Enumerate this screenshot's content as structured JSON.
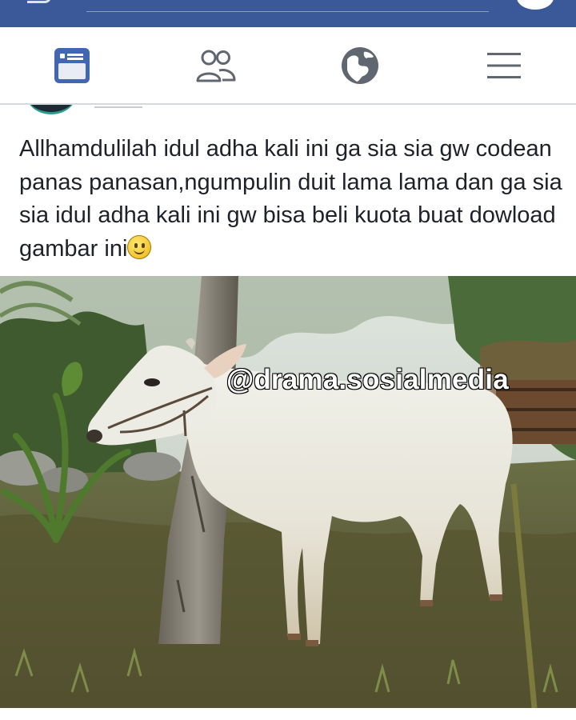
{
  "topbar": {
    "background_color": "#3b5998",
    "left_icon": "partial-icon",
    "right_icon": "messenger-icon"
  },
  "navbar": {
    "items": [
      {
        "icon": "news-feed-icon",
        "active": true,
        "color": "#4267b2"
      },
      {
        "icon": "friends-icon",
        "active": false,
        "color": "#616770"
      },
      {
        "icon": "globe-icon",
        "active": false,
        "color": "#616770"
      },
      {
        "icon": "menu-icon",
        "active": false,
        "color": "#616770"
      }
    ]
  },
  "post": {
    "text": "Allhamdulilah idul adha kali ini  ga sia sia gw codean panas panasan,ngumpulin duit lama lama dan ga sia sia idul adha kali ini gw bisa beli kuota buat dowload gambar ini",
    "emoji": "smiley-face-emoji",
    "image": {
      "subject": "white-cow-photo",
      "watermark": "@drama.sosialmedia"
    }
  }
}
